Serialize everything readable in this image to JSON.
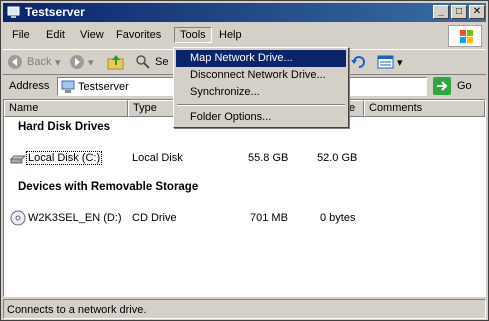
{
  "window": {
    "title": "Testserver"
  },
  "menu": {
    "items": [
      "File",
      "Edit",
      "View",
      "Favorites",
      "Tools",
      "Help"
    ]
  },
  "toolbar": {
    "back_label": "Back",
    "search_label": "Se"
  },
  "address": {
    "label": "Address",
    "value": "Testserver",
    "go_label": "Go"
  },
  "columns": {
    "name": "Name",
    "type": "Type",
    "size": "e",
    "comments": "Comments"
  },
  "groups": [
    {
      "title": "Hard Disk Drives",
      "items": [
        {
          "name": "Local Disk (C:)",
          "type": "Local Disk",
          "total": "55.8 GB",
          "free": "52.0 GB"
        }
      ]
    },
    {
      "title": "Devices with Removable Storage",
      "items": [
        {
          "name": "W2K3SEL_EN (D:)",
          "type": "CD Drive",
          "total": "701 MB",
          "free": "0 bytes"
        }
      ]
    }
  ],
  "tools_menu": {
    "items": [
      "Map Network Drive...",
      "Disconnect Network Drive...",
      "Synchronize...",
      "Folder Options..."
    ]
  },
  "status": {
    "text": "Connects to a network drive."
  },
  "colors": {
    "titlebar": "#0a246a",
    "highlight": "#0a246a"
  }
}
